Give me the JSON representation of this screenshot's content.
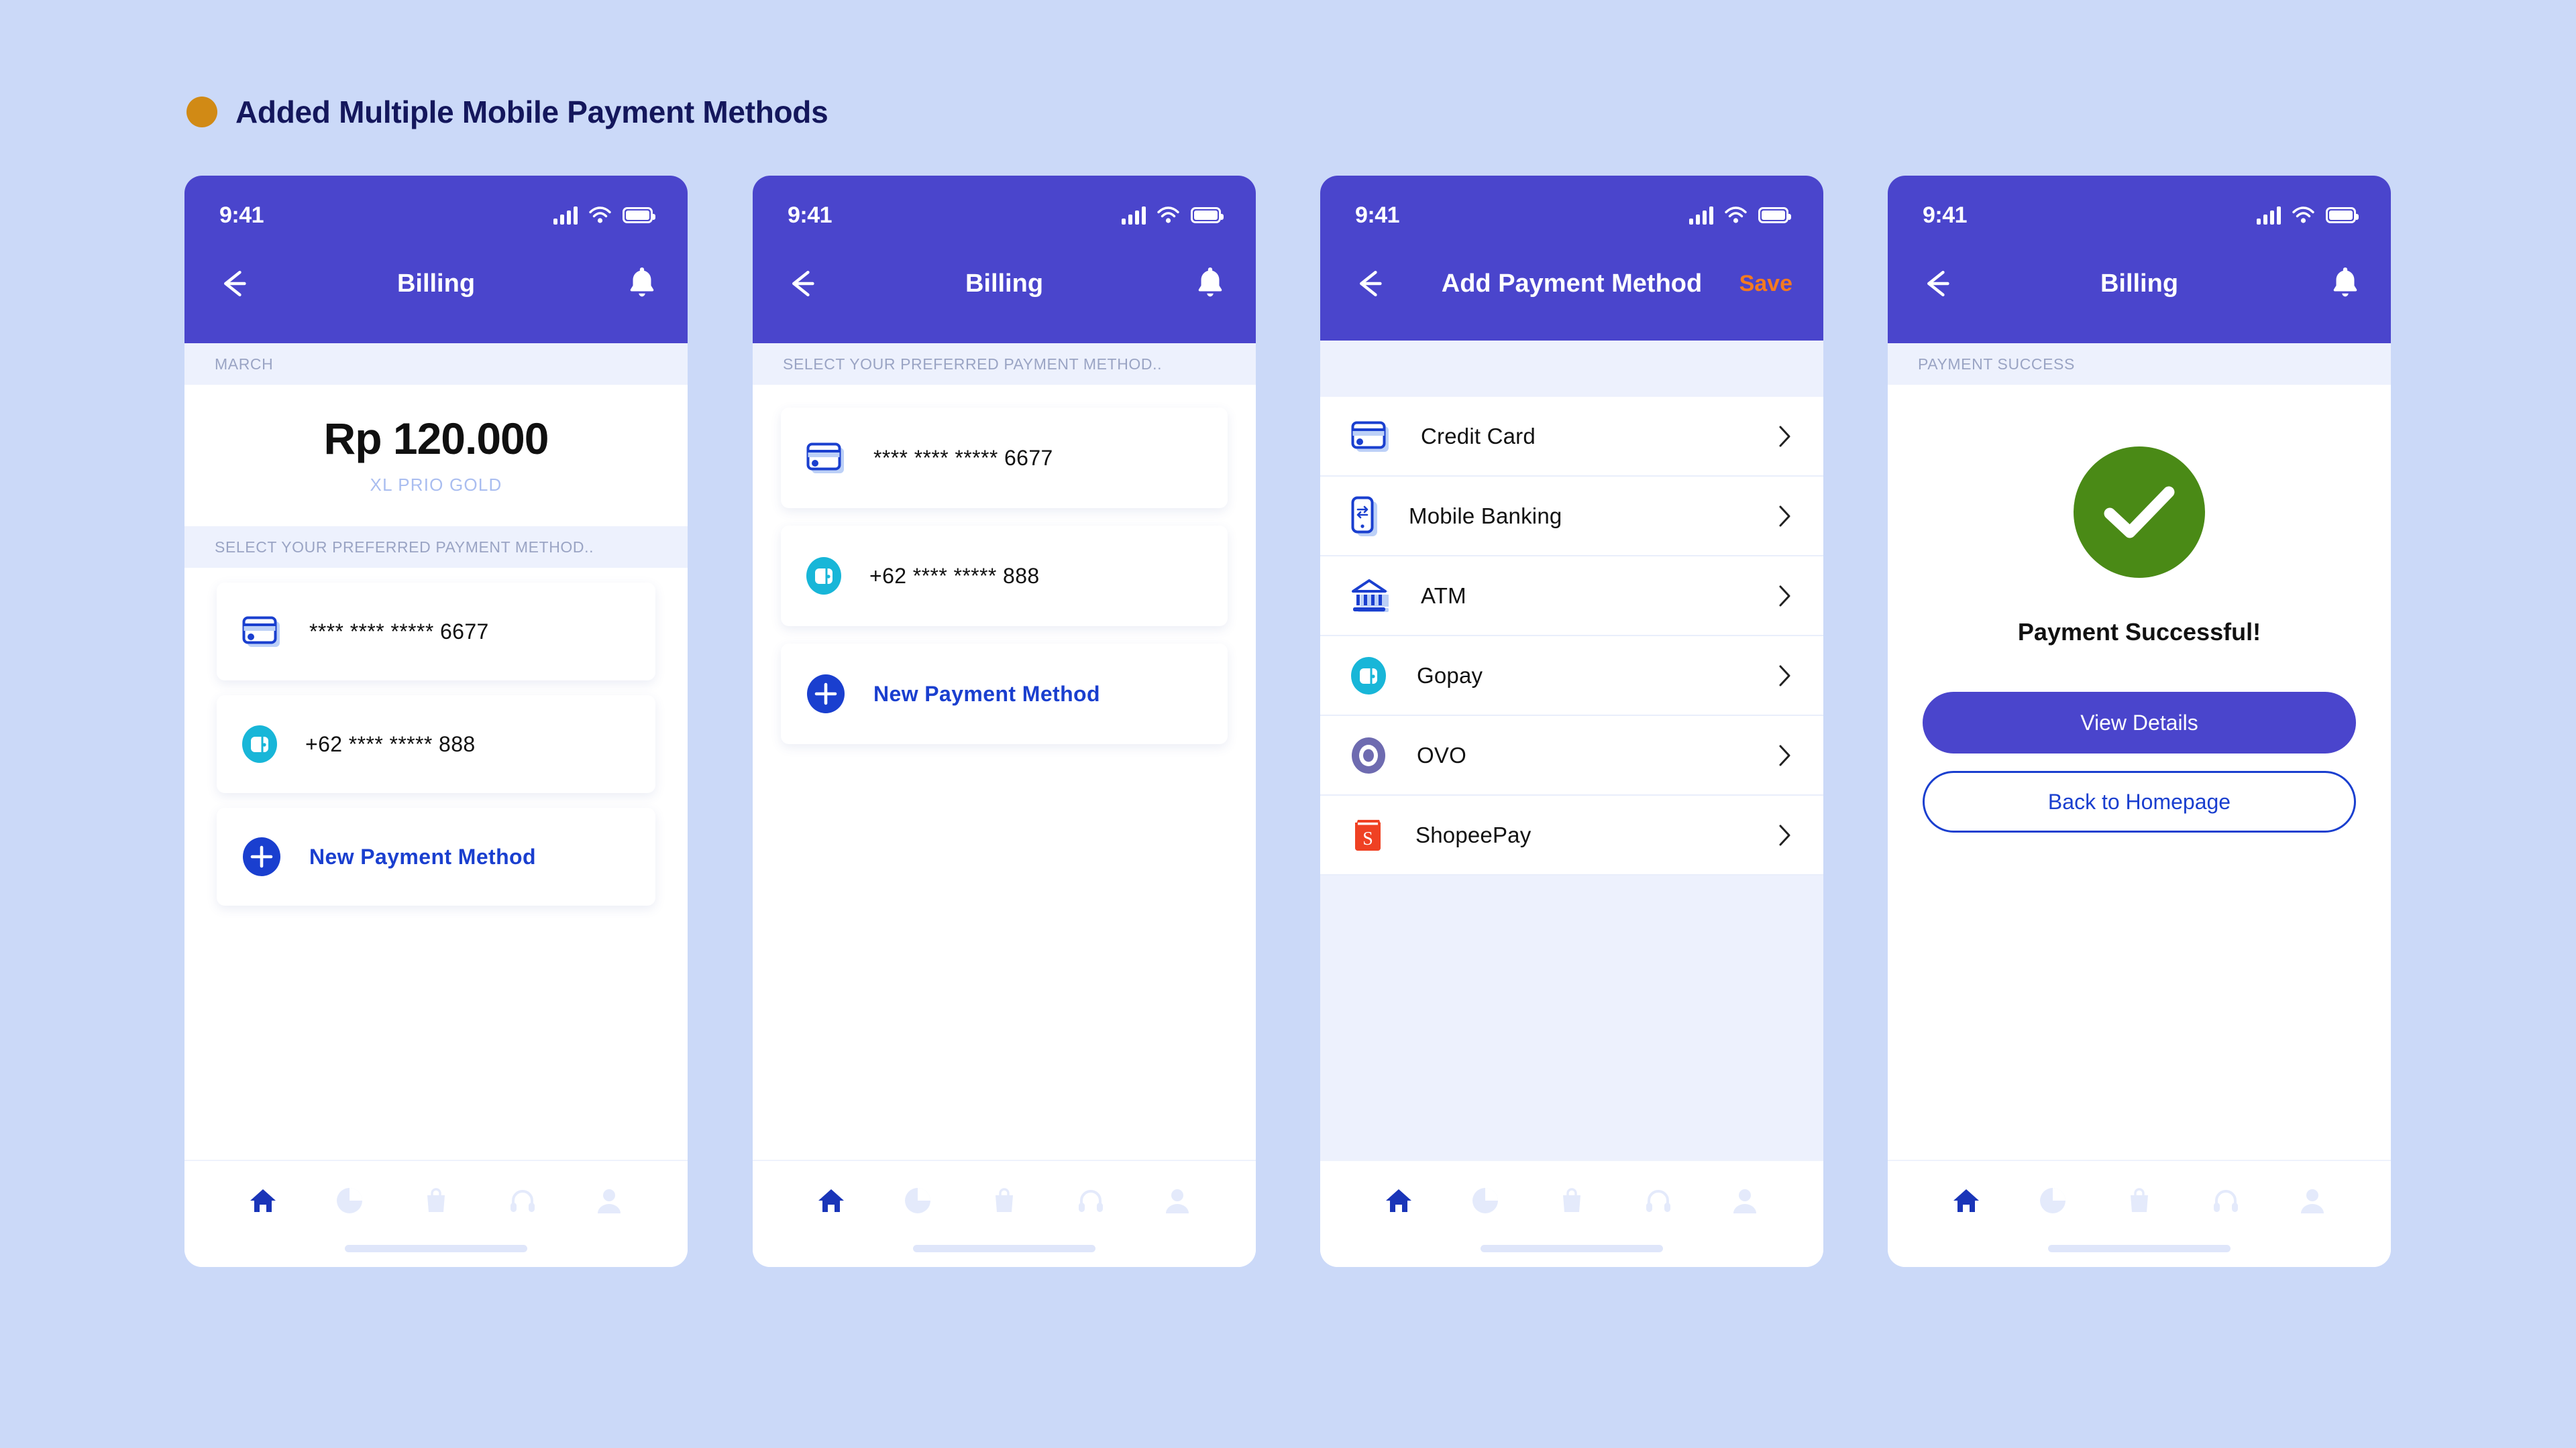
{
  "header": {
    "title": "Added Multiple Mobile Payment Methods",
    "bullet_color": "#d18a15",
    "title_color": "#14175c"
  },
  "theme": {
    "page_background": "#cbd9f8",
    "primary": "#4a45cc",
    "accent_blue": "#1a3fcf",
    "accent_orange": "#f47a20",
    "success_green": "#4a8a16",
    "strip_background": "#edf1fd",
    "gopay_cyan": "#18b6d8",
    "ovo_purple": "#6e6bb0",
    "shopee_orange": "#ef4123"
  },
  "status_bar": {
    "time": "9:41",
    "icons": [
      "signal-icon",
      "wifi-icon",
      "battery-icon"
    ]
  },
  "screens": [
    {
      "id": "billing-overview",
      "nav": {
        "back_icon": "arrow-left-icon",
        "title": "Billing",
        "right_icon": "bell-icon"
      },
      "strip": "MARCH",
      "amount": "Rp 120.000",
      "plan": "XL PRIO GOLD",
      "strip2": "SELECT YOUR PREFERRED PAYMENT METHOD..",
      "methods": [
        {
          "icon": "credit-card-icon",
          "label": "**** **** ***** 6677"
        },
        {
          "icon": "wallet-icon",
          "label": "+62 **** ***** 888"
        },
        {
          "icon": "plus-circle-icon",
          "label": "New Payment Method",
          "accent": true
        }
      ]
    },
    {
      "id": "select-payment-method",
      "nav": {
        "back_icon": "arrow-left-icon",
        "title": "Billing",
        "right_icon": "bell-icon"
      },
      "strip": "SELECT YOUR PREFERRED PAYMENT METHOD..",
      "methods": [
        {
          "icon": "credit-card-icon",
          "label": "**** **** ***** 6677"
        },
        {
          "icon": "wallet-icon",
          "label": "+62 **** ***** 888"
        },
        {
          "icon": "plus-circle-icon",
          "label": "New Payment Method",
          "accent": true
        }
      ]
    },
    {
      "id": "add-payment-method",
      "nav": {
        "back_icon": "arrow-left-icon",
        "title": "Add Payment Method",
        "save_label": "Save"
      },
      "options": [
        {
          "icon": "credit-card-icon",
          "label": "Credit Card"
        },
        {
          "icon": "mobile-banking-icon",
          "label": "Mobile Banking"
        },
        {
          "icon": "atm-icon",
          "label": "ATM"
        },
        {
          "icon": "gopay-icon",
          "label": "Gopay"
        },
        {
          "icon": "ovo-icon",
          "label": "OVO"
        },
        {
          "icon": "shopeepay-icon",
          "label": "ShopeePay"
        }
      ]
    },
    {
      "id": "payment-success",
      "nav": {
        "back_icon": "arrow-left-icon",
        "title": "Billing",
        "right_icon": "bell-icon"
      },
      "strip": "PAYMENT SUCCESS",
      "check_icon": "check-circle-icon",
      "message": "Payment Successful!",
      "primary_button": "View Details",
      "secondary_button": "Back to Homepage"
    }
  ],
  "tabbar": {
    "items": [
      {
        "icon": "home-icon",
        "active": true
      },
      {
        "icon": "pie-chart-icon",
        "active": false
      },
      {
        "icon": "shopping-bag-icon",
        "active": false
      },
      {
        "icon": "headphones-icon",
        "active": false
      },
      {
        "icon": "person-icon",
        "active": false
      }
    ],
    "active_color": "#1a35b8",
    "inactive_color": "#e4eafb"
  }
}
